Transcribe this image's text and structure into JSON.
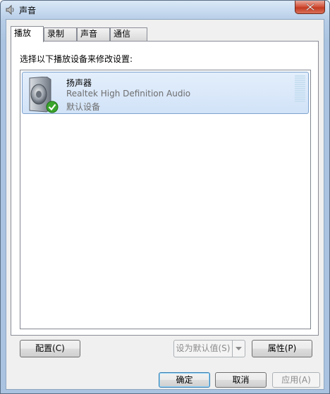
{
  "window": {
    "title": "声音"
  },
  "tabs": [
    {
      "label": "播放",
      "active": true
    },
    {
      "label": "录制",
      "active": false
    },
    {
      "label": "声音",
      "active": false
    },
    {
      "label": "通信",
      "active": false
    }
  ],
  "playback": {
    "instruction": "选择以下播放设备来修改设置:",
    "devices": [
      {
        "name": "扬声器",
        "description": "Realtek High Definition Audio",
        "status": "默认设备",
        "icon": "speaker-icon",
        "default_badge": "check-icon"
      }
    ]
  },
  "buttons": {
    "configure": "配置(C)",
    "set_default": "设为默认值(S)",
    "properties": "属性(P)",
    "ok": "确定",
    "cancel": "取消",
    "apply": "应用(A)"
  },
  "colors": {
    "selection": "#d2e3f8",
    "check_green": "#3aa52c",
    "close_red": "#c23b21"
  }
}
